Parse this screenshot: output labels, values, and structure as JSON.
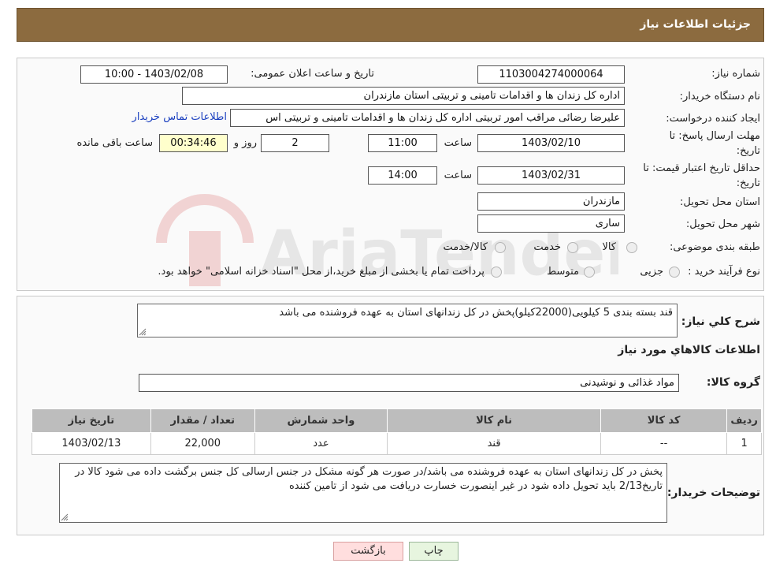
{
  "header": {
    "title": "جزئیات اطلاعات نیاز"
  },
  "form": {
    "need_number_label": "شماره نیاز:",
    "need_number": "1103004274000064",
    "announce_label": "تاریخ و ساعت اعلان عمومی:",
    "announce_value": "1403/02/08 - 10:00",
    "buyer_org_label": "نام دستگاه خریدار:",
    "buyer_org": "اداره کل زندان ها و اقدامات تامینی و تربیتی استان مازندران",
    "creator_label": "ایجاد کننده درخواست:",
    "creator": "علیرضا رضائی مراقب امور تربیتی اداره کل زندان ها و اقدامات تامینی و تربیتی اس",
    "contact_link": "اطلاعات تماس خریدار",
    "deadline_label_1": "مهلت ارسال پاسخ: تا",
    "deadline_label_2": "تاریخ:",
    "deadline_date": "1403/02/10",
    "time_label": "ساعت",
    "deadline_time": "11:00",
    "days_value": "2",
    "days_label": "روز و",
    "remaining_time": "00:34:46",
    "remaining_label": "ساعت باقی مانده",
    "validity_label_1": "حداقل تاریخ اعتبار قیمت: تا",
    "validity_label_2": "تاریخ:",
    "validity_date": "1403/02/31",
    "validity_time_label": "ساعت",
    "validity_time": "14:00",
    "province_label": "استان محل تحویل:",
    "province": "مازندران",
    "city_label": "شهر محل تحویل:",
    "city": "ساری",
    "category_label": "طبقه بندی موضوعی:",
    "category_options": [
      "کالا",
      "خدمت",
      "کالا/خدمت"
    ],
    "process_label": "نوع فرآیند خرید :",
    "process_options": [
      "جزیی",
      "متوسط"
    ],
    "payment_note": "پرداخت تمام یا بخشی از مبلغ خرید،از محل \"اسناد خزانه اسلامی\" خواهد بود."
  },
  "details": {
    "summary_label": "شرح کلي نياز:",
    "summary": "قند بسته بندی 5 کیلویی(22000کیلو)پخش در کل زندانهای استان به عهده فروشنده می باشد",
    "goods_info_title": "اطلاعات کالاهاي مورد نياز",
    "goods_group_label": "گروه کالا:",
    "goods_group": "مواد غذائی و نوشیدنی",
    "table": {
      "headers": [
        "رديف",
        "کد کالا",
        "نام کالا",
        "واحد شمارش",
        "تعداد / مقدار",
        "تاريخ نياز"
      ],
      "rows": [
        [
          "1",
          "--",
          "قند",
          "عدد",
          "22,000",
          "1403/02/13"
        ]
      ]
    },
    "buyer_notes_label": "توضیحات خریدار:",
    "buyer_notes": "پخش در کل زندانهای استان به عهده فروشنده می باشد/در صورت هر گونه مشکل در جنس ارسالی کل جنس برگشت داده می شود کالا در تاریخ2/13 باید تحویل داده شود در غیر اینصورت خسارت دریافت می شود از تامین کننده"
  },
  "buttons": {
    "back": "بازگشت",
    "print": "چاپ"
  },
  "watermark_text": "AriaTender.neT",
  "colors": {
    "header_bg": "#8c6b3f",
    "link": "#1a3fbf",
    "remaining_bg": "#ffffcc"
  }
}
